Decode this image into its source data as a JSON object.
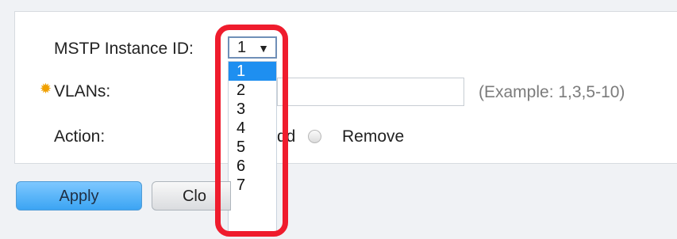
{
  "form": {
    "mstp_instance_label": "MSTP Instance ID:",
    "mstp_instance_value": "1",
    "mstp_instance_options": [
      "1",
      "2",
      "3",
      "4",
      "5",
      "6",
      "7"
    ],
    "vlans_label": "VLANs:",
    "vlans_value": "",
    "vlans_hint": "(Example: 1,3,5-10)",
    "action_label": "Action:",
    "action_add_visible": "dd",
    "action_remove_label": "Remove"
  },
  "buttons": {
    "apply": "Apply",
    "close_visible": "Clo"
  },
  "colors": {
    "highlight": "#ef1c2d",
    "selected_option_bg": "#1e8ff0",
    "apply_button": "#3ba4f3",
    "required_icon": "#f0a000"
  },
  "icons": {
    "required": "gear-icon",
    "dropdown": "caret-down-icon",
    "radio": "radio-icon"
  }
}
